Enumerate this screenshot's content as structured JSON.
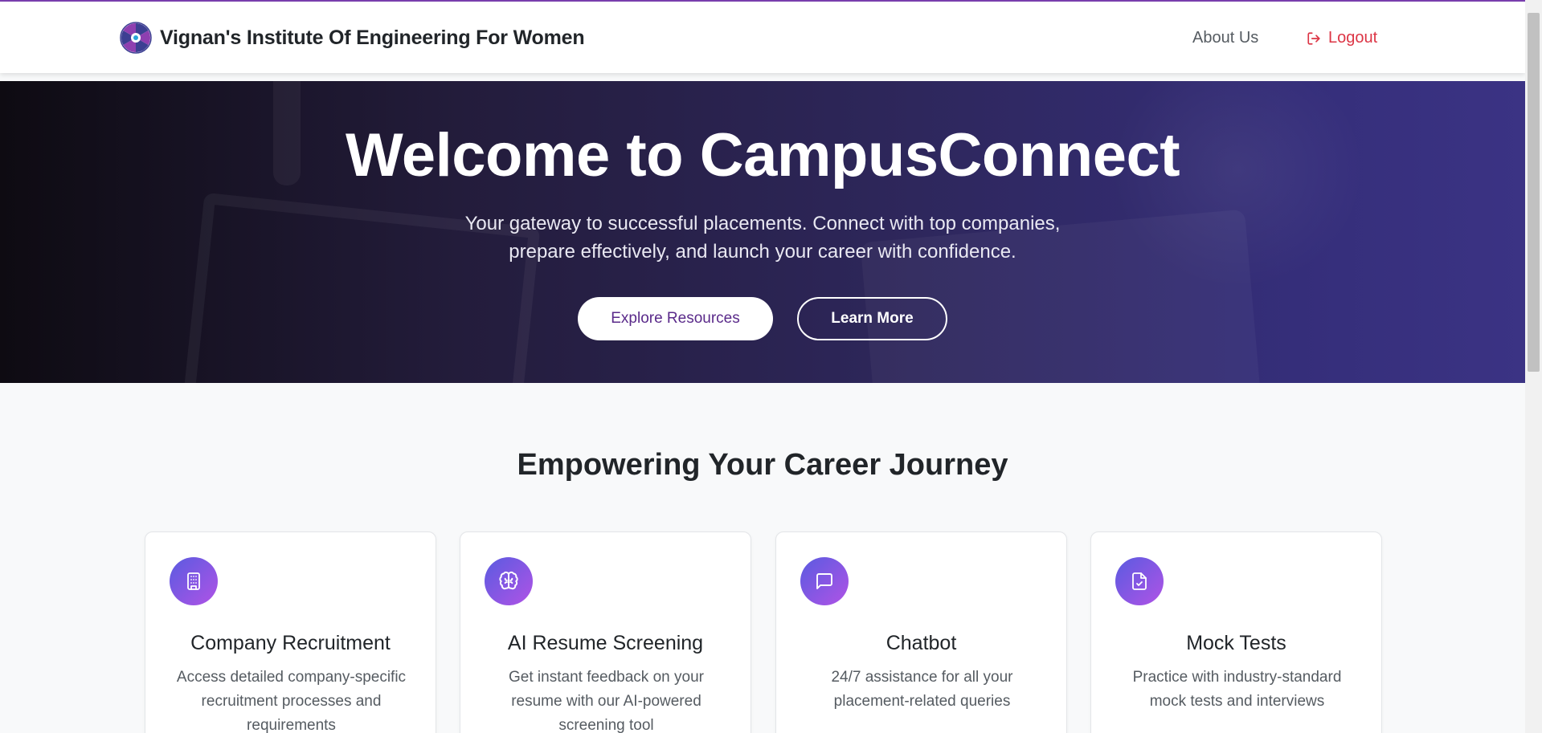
{
  "navbar": {
    "brand_name": "Vignan's Institute Of Engineering For Women",
    "about_label": "About Us",
    "logout_label": "Logout"
  },
  "hero": {
    "title": "Welcome to CampusConnect",
    "subtitle": "Your gateway to successful placements. Connect with top companies, prepare effectively, and launch your career with confidence.",
    "explore_label": "Explore Resources",
    "learn_label": "Learn More"
  },
  "features": {
    "heading": "Empowering Your Career Journey",
    "cards": [
      {
        "icon": "building-icon",
        "title": "Company Recruitment",
        "text": "Access detailed company-specific recruitment processes and requirements"
      },
      {
        "icon": "brain-icon",
        "title": "AI Resume Screening",
        "text": "Get instant feedback on your resume with our AI-powered screening tool"
      },
      {
        "icon": "chat-icon",
        "title": "Chatbot",
        "text": "24/7 assistance for all your placement-related queries"
      },
      {
        "icon": "file-check-icon",
        "title": "Mock Tests",
        "text": "Practice with industry-standard mock tests and interviews"
      }
    ]
  },
  "colors": {
    "accent": "#7b3fb1",
    "logout": "#dc3545",
    "hero_start": "#0e0b12",
    "hero_end": "#3b3384",
    "icon_gradient_start": "#5a5be0",
    "icon_gradient_end": "#b053e6"
  }
}
